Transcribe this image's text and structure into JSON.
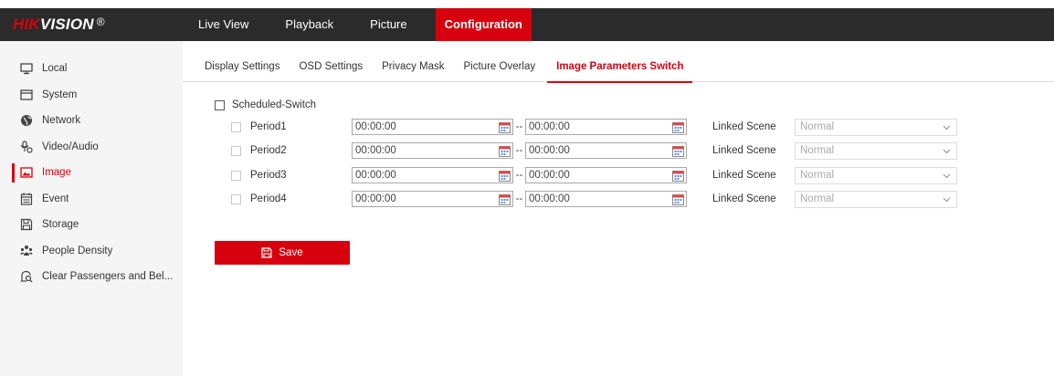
{
  "logo": {
    "hik": "HIK",
    "vision": "VISION",
    "reg": "®"
  },
  "nav": {
    "items": [
      {
        "label": "Live View"
      },
      {
        "label": "Playback"
      },
      {
        "label": "Picture"
      },
      {
        "label": "Configuration"
      }
    ],
    "active": "Configuration"
  },
  "sidebar": {
    "items": [
      {
        "label": "Local",
        "icon": "monitor-icon"
      },
      {
        "label": "System",
        "icon": "system-icon"
      },
      {
        "label": "Network",
        "icon": "globe-icon"
      },
      {
        "label": "Video/Audio",
        "icon": "video-audio-icon"
      },
      {
        "label": "Image",
        "icon": "image-icon"
      },
      {
        "label": "Event",
        "icon": "calendar-icon"
      },
      {
        "label": "Storage",
        "icon": "storage-icon"
      },
      {
        "label": "People Density",
        "icon": "people-icon"
      },
      {
        "label": "Clear Passengers and Bel...",
        "icon": "search-bell-icon"
      }
    ],
    "active": "Image"
  },
  "tabs": {
    "items": [
      {
        "label": "Display Settings"
      },
      {
        "label": "OSD Settings"
      },
      {
        "label": "Privacy Mask"
      },
      {
        "label": "Picture Overlay"
      },
      {
        "label": "Image Parameters Switch"
      }
    ],
    "active": "Image Parameters Switch"
  },
  "schedule": {
    "label": "Scheduled-Switch",
    "checked": false
  },
  "periods": [
    {
      "label": "Period1",
      "start": "00:00:00",
      "end": "00:00:00",
      "linked_label": "Linked Scene",
      "scene": "Normal"
    },
    {
      "label": "Period2",
      "start": "00:00:00",
      "end": "00:00:00",
      "linked_label": "Linked Scene",
      "scene": "Normal"
    },
    {
      "label": "Period3",
      "start": "00:00:00",
      "end": "00:00:00",
      "linked_label": "Linked Scene",
      "scene": "Normal"
    },
    {
      "label": "Period4",
      "start": "00:00:00",
      "end": "00:00:00",
      "linked_label": "Linked Scene",
      "scene": "Normal"
    }
  ],
  "separator": "--",
  "save_label": "Save",
  "colors": {
    "accent": "#d7000f",
    "topbar": "#2b2b2b",
    "sidebar": "#f5f5f5"
  }
}
